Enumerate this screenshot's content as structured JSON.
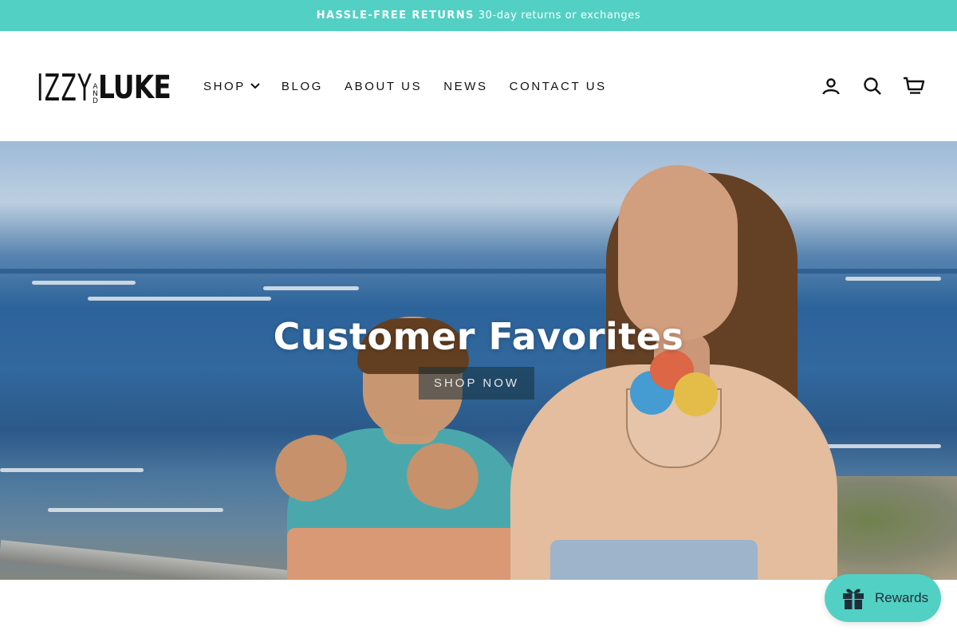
{
  "announcement": {
    "bold": "HASSLE-FREE RETURNS",
    "text": "30-day returns or exchanges"
  },
  "logo": {
    "izzy": "IZZY",
    "and": [
      "A",
      "N",
      "D"
    ],
    "luke": "LUKE"
  },
  "nav": {
    "shop": "SHOP",
    "blog": "BLOG",
    "about": "ABOUT US",
    "news": "NEWS",
    "contact": "CONTACT US"
  },
  "header_icons": [
    "user-icon",
    "search-icon",
    "cart-icon"
  ],
  "hero": {
    "title": "Customer Favorites",
    "button": "SHOP NOW"
  },
  "rewards": {
    "label": "Rewards",
    "icon": "gift-icon"
  },
  "colors": {
    "accent": "#52d0c3",
    "text": "#111111",
    "button_overlay": "#14323c"
  }
}
